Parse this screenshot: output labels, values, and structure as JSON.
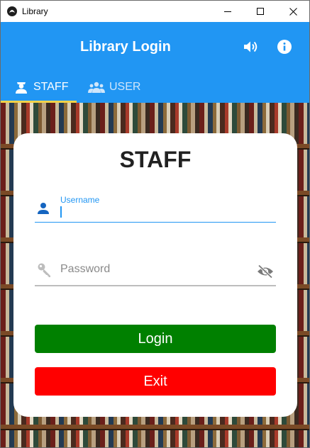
{
  "window": {
    "title": "Library",
    "icons": [
      "app-logo-icon",
      "minimize-icon",
      "maximize-icon",
      "close-icon"
    ]
  },
  "appbar": {
    "title": "Library Login",
    "actions": [
      "volume-icon",
      "info-icon"
    ]
  },
  "tabs": [
    {
      "label": "STAFF",
      "icon": "staff-icon",
      "active": true
    },
    {
      "label": "USER",
      "icon": "users-icon",
      "active": false
    }
  ],
  "form": {
    "heading": "STAFF",
    "username": {
      "label": "Username",
      "value": "",
      "focused": true,
      "icon": "person-icon"
    },
    "password": {
      "placeholder": "Password",
      "value": "",
      "icon": "key-icon",
      "toggle_icon": "eye-off-icon"
    },
    "login_label": "Login",
    "exit_label": "Exit"
  },
  "colors": {
    "primary": "#2196f3",
    "tab_indicator": "#f2d34a",
    "login": "#008000",
    "exit": "#ff0000"
  }
}
